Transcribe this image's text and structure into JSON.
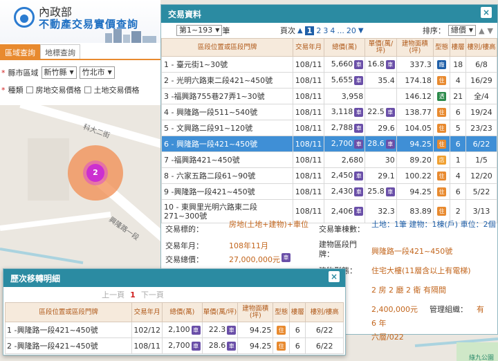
{
  "brand": {
    "line1": "內政部",
    "line2": "不動產交易實價查詢"
  },
  "left": {
    "tabs": [
      {
        "label": "區域查詢",
        "active": true
      },
      {
        "label": "地標查詢",
        "active": false
      }
    ],
    "filters": {
      "county_label": "縣市區域",
      "county_value": "新竹縣",
      "district_value": "竹北市",
      "type_label": "種類",
      "opt_house": "房地交易價格",
      "opt_land": "土地交易價格"
    }
  },
  "map": {
    "cluster_count": "2",
    "street1": "科大二街",
    "street2": "興隆路一段",
    "park": "綠九公園"
  },
  "results": {
    "title": "交易資料",
    "close": "×",
    "range_value": "第1~193",
    "range_suffix": "筆",
    "page_label": "頁次",
    "pages": [
      "1",
      "2",
      "3",
      "4",
      "...",
      "20"
    ],
    "sort_label": "排序：",
    "sort_value": "總價",
    "columns": [
      "區段位置或區段門牌",
      "交易年月",
      "總價(萬)",
      "單價(萬/坪)",
      "建物面積(坪)",
      "型態",
      "樓層",
      "樓別/樓高"
    ],
    "rows": [
      {
        "addr": "1 - 臺元街1~30號",
        "ym": "108/11",
        "total": "5,660",
        "car": true,
        "unit": "16.8",
        "unit_car": true,
        "area": "337.3",
        "type": "廠",
        "type_color": "#1f5fa8",
        "floors": "18",
        "level": "6/8"
      },
      {
        "addr": "2 - 光明六路東二段421~450號",
        "ym": "108/11",
        "total": "5,655",
        "car": true,
        "unit": "35.4",
        "unit_car": false,
        "area": "174.18",
        "type": "住",
        "type_color": "#e88a2f",
        "floors": "4",
        "level": "16/29"
      },
      {
        "addr": "3 -福興路755巷27弄1~30號",
        "ym": "108/11",
        "total": "3,958",
        "car": false,
        "unit": "",
        "unit_car": false,
        "area": "146.12",
        "type": "透",
        "type_color": "#2b8a4a",
        "floors": "21",
        "level": "全/4"
      },
      {
        "addr": "4 - 興隆路一段511~540號",
        "ym": "108/11",
        "total": "3,118",
        "car": true,
        "unit": "22.5",
        "unit_car": true,
        "area": "138.77",
        "type": "住",
        "type_color": "#e88a2f",
        "floors": "6",
        "level": "19/24"
      },
      {
        "addr": "5 - 文興路二段91~120號",
        "ym": "108/11",
        "total": "2,788",
        "car": true,
        "unit": "29.6",
        "unit_car": false,
        "area": "104.05",
        "type": "住",
        "type_color": "#e88a2f",
        "floors": "5",
        "level": "23/23"
      },
      {
        "addr": "6 - 興隆路一段421~450號",
        "ym": "108/11",
        "total": "2,700",
        "car": true,
        "unit": "28.6",
        "unit_car": true,
        "area": "94.25",
        "type": "住",
        "type_color": "#e88a2f",
        "floors": "6",
        "level": "6/22",
        "selected": true
      },
      {
        "addr": "7 -福興路421~450號",
        "ym": "108/11",
        "total": "2,680",
        "car": false,
        "unit": "30",
        "unit_car": false,
        "area": "89.20",
        "type": "店",
        "type_color": "#f0a030",
        "floors": "1",
        "level": "1/5"
      },
      {
        "addr": "8 - 六家五路二段61~90號",
        "ym": "108/11",
        "total": "2,450",
        "car": true,
        "unit": "29.1",
        "unit_car": false,
        "area": "100.22",
        "type": "住",
        "type_color": "#e88a2f",
        "floors": "4",
        "level": "12/20"
      },
      {
        "addr": "9 -興隆路一段421~450號",
        "ym": "108/11",
        "total": "2,430",
        "car": true,
        "unit": "25.8",
        "unit_car": true,
        "area": "94.25",
        "type": "住",
        "type_color": "#e88a2f",
        "floors": "6",
        "level": "5/22"
      },
      {
        "addr": "10 - 東興里光明六路東二段271~300號",
        "ym": "108/11",
        "total": "2,406",
        "car": true,
        "unit": "32.3",
        "unit_car": false,
        "area": "83.89",
        "type": "住",
        "type_color": "#e88a2f",
        "floors": "2",
        "level": "3/13",
        "tall": true
      }
    ],
    "detail": {
      "target_label": "交易標的：",
      "target_value": "房地(土地+建物)+車位",
      "ym_label": "交易年月：",
      "ym_value": "108年11月",
      "total_label": "交易總價：",
      "total_value": "27,000,000元",
      "count_label": "交易筆棟數：",
      "count_value": "土地：1筆 建物：1棟(戶) 車位：2個",
      "addr_label": "建物區段門牌：",
      "addr_value": "興隆路一段421~450號",
      "form_label": "建物型態：",
      "form_value": "住宅大樓(11層含以上有電梯)",
      "layout_value": "2 房 2 廳 2 衛 有隔間",
      "car_price_value": "2,400,000元",
      "mgmt_label": "管理組織：",
      "mgmt_value": "有",
      "age_value": "6 年",
      "floor_value": "六層/022"
    }
  },
  "history": {
    "title": "歷次移轉明細",
    "close": "×",
    "prev": "上一頁",
    "page": "1",
    "next": "下一頁",
    "columns": [
      "區段位置或區段門牌",
      "交易年月",
      "總價(萬)",
      "單價(萬/坪)",
      "建物面積(坪)",
      "型態",
      "樓層",
      "樓別/樓高"
    ],
    "rows": [
      {
        "addr": "1 -興隆路一段421~450號",
        "ym": "102/12",
        "total": "2,100",
        "unit": "22.3",
        "area": "94.25",
        "type": "住",
        "floors": "6",
        "level": "6/22"
      },
      {
        "addr": "2 -興隆路一段421~450號",
        "ym": "108/11",
        "total": "2,700",
        "unit": "28.6",
        "area": "94.25",
        "type": "住",
        "floors": "6",
        "level": "6/22"
      }
    ]
  },
  "icons": {
    "car_badge": "車",
    "colors": {
      "accent": "#2b8ba2",
      "tab": "#e88a2f",
      "selected_row": "#3f8fd6",
      "car": "#6a4fa8"
    }
  }
}
